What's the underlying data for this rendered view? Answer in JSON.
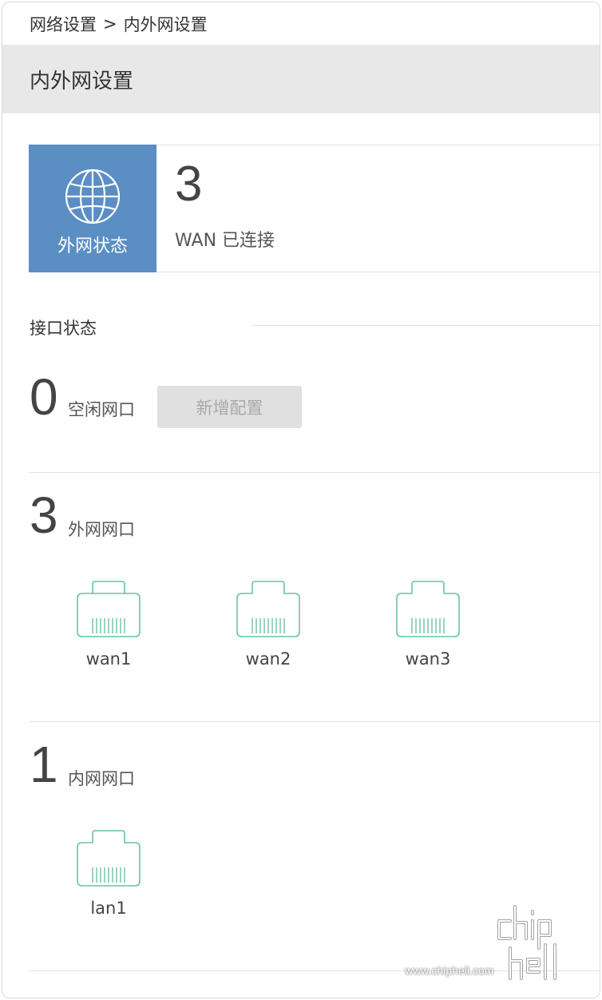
{
  "breadcrumb": {
    "parent": "网络设置",
    "separator": ">",
    "current": "内外网设置"
  },
  "page_title": "内外网设置",
  "wan_status": {
    "card_label": "外网状态",
    "card_icon": "globe-icon",
    "count": "3",
    "connected_text": "WAN 已连接",
    "accent_color": "#5b8ec3"
  },
  "interface_status": {
    "title": "接口状态",
    "idle": {
      "count": "0",
      "label": "空闲网口",
      "add_button": "新增配置"
    },
    "wan": {
      "count": "3",
      "label": "外网网口",
      "ports": [
        "wan1",
        "wan2",
        "wan3"
      ]
    },
    "lan": {
      "count": "1",
      "label": "内网网口",
      "ports": [
        "lan1"
      ]
    },
    "port_icon": "ethernet-port-icon",
    "port_color": "#6cc3a0"
  },
  "watermark": {
    "logo_text": "chip hell",
    "url": "www.chiphell.com"
  }
}
